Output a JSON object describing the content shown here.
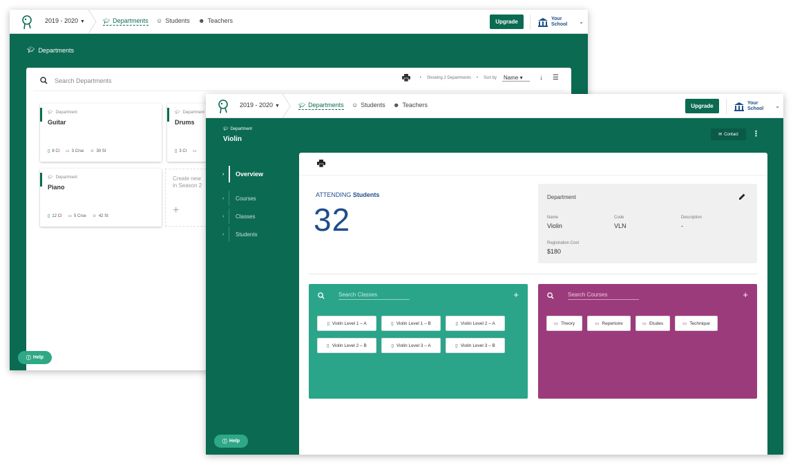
{
  "colors": {
    "brand": "#0b6a52",
    "teal": "#2aa58a",
    "plum": "#9c3b7c",
    "navy": "#1d4e89"
  },
  "nav": {
    "year": "2019 - 2020",
    "links": [
      "Departments",
      "Students",
      "Teachers"
    ],
    "upgrade": "Upgrade",
    "school_line1": "Your",
    "school_line2": "School"
  },
  "back": {
    "page_title": "Departments",
    "search_placeholder": "Search Departments",
    "showing": "Showing 2 Departments",
    "sort_by": "Sort by",
    "sort_value": "Name",
    "cards": [
      {
        "label": "Department",
        "name": "Guitar",
        "classes": "8 Cl",
        "courses": "3 Crse",
        "students": "30 St"
      },
      {
        "label": "Department",
        "name": "Drums",
        "classes": "3 Cl"
      },
      {
        "label": "Department",
        "name": "Piano",
        "classes": "12 Cl",
        "courses": "5 Crse",
        "students": "42 St"
      }
    ],
    "create_line1": "Create new",
    "create_line2": "in Season 2",
    "help": "Help"
  },
  "front": {
    "dept_label": "Department",
    "dept_name": "Violin",
    "contact": "Contact",
    "sidenav": [
      "Overview",
      "Courses",
      "Classes",
      "Students"
    ],
    "attending_prefix": "ATTENDING",
    "attending_suffix": "Students",
    "attending_count": "32",
    "info": {
      "heading": "Department",
      "name_label": "Name",
      "name": "Violin",
      "code_label": "Code",
      "code": "VLN",
      "desc_label": "Description",
      "desc": "-",
      "cost_label": "Registration Cost",
      "cost": "$180"
    },
    "classes_placeholder": "Search Classes",
    "classes": [
      "Violin Level 1 – A",
      "Violin Level 1 – B",
      "Violin Level 2 – A",
      "Violin Level 2 – B",
      "Violin Level 3 – A",
      "Violin Level 3 – B"
    ],
    "courses_placeholder": "Search Courses",
    "courses": [
      "Theory",
      "Repertoire",
      "Etudes",
      "Technique"
    ],
    "help": "Help"
  }
}
